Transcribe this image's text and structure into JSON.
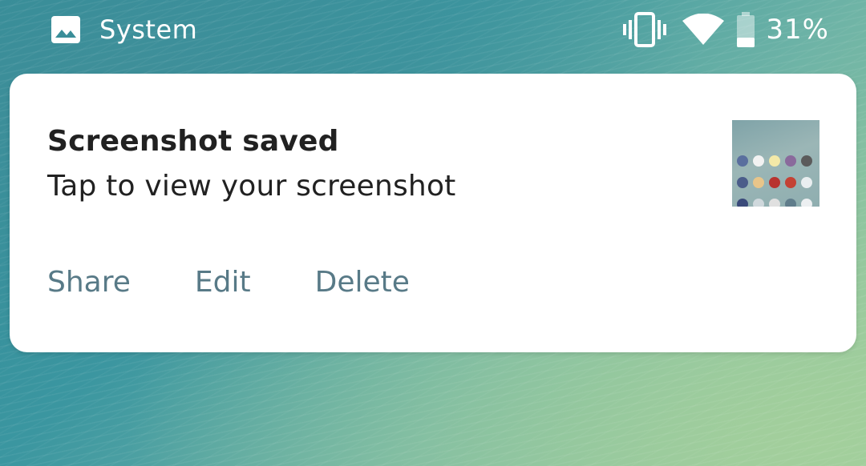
{
  "status_bar": {
    "app_name": "System",
    "battery_percent": "31%",
    "battery_level": 0.31,
    "icons": [
      "image-icon",
      "vibrate-icon",
      "wifi-icon",
      "battery-icon"
    ]
  },
  "notification": {
    "title": "Screenshot saved",
    "body": "Tap to view your screenshot",
    "actions": [
      {
        "label": "Share"
      },
      {
        "label": "Edit"
      },
      {
        "label": "Delete"
      }
    ],
    "thumbnail_icon_colors": [
      "#5a6f9e",
      "#f2f2f2",
      "#f3e9a8",
      "#8a6a9c",
      "#5b5b5b",
      "#4b5d8a",
      "#e8c58a",
      "#b8332f",
      "#c44235",
      "#e9eef0",
      "#3a4a7a",
      "#cfd8dc",
      "#e0e0e0",
      "#607d8b",
      "#eceff1"
    ]
  },
  "colors": {
    "action_text": "#587a87",
    "title_text": "#212121",
    "card_background": "#ffffff"
  }
}
